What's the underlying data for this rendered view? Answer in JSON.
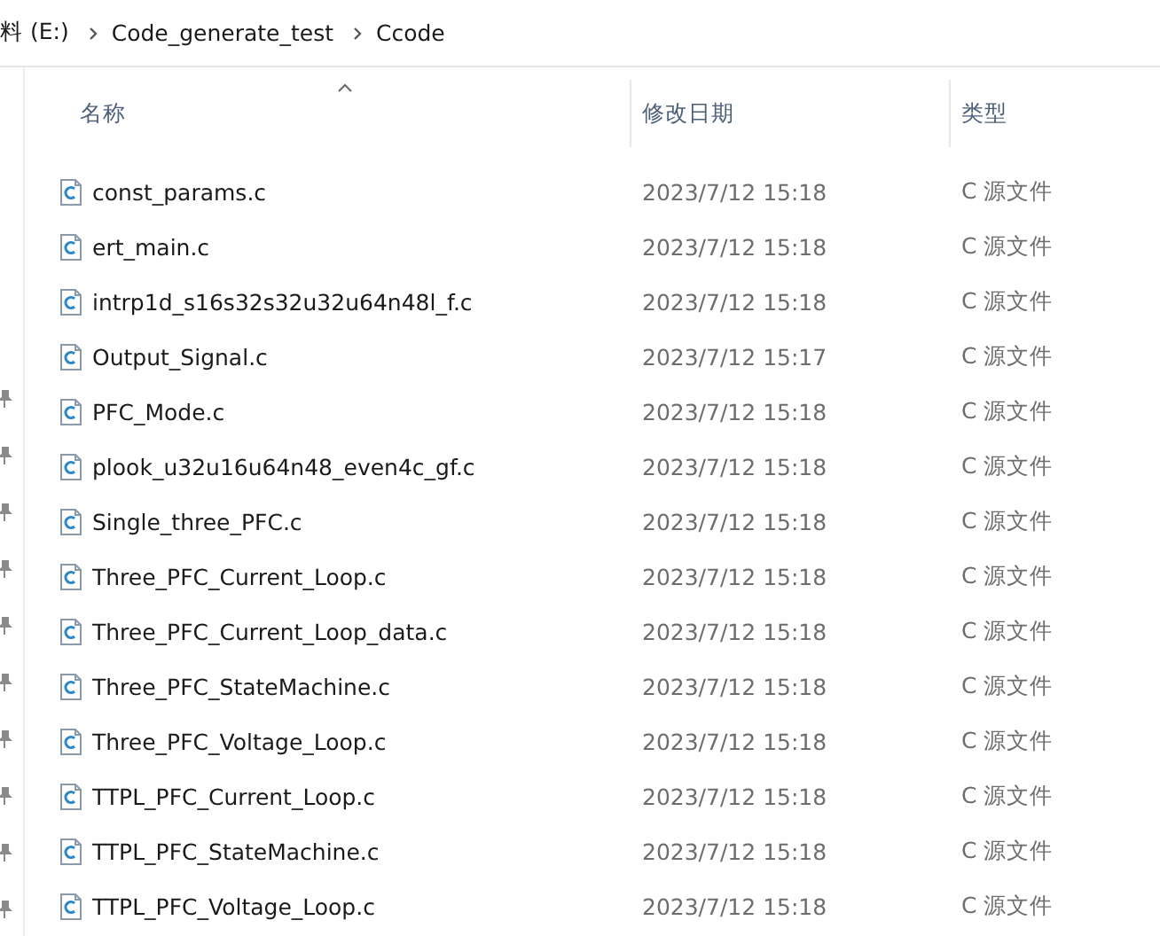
{
  "breadcrumb": [
    "料 (E:)",
    "Code_generate_test",
    "Ccode"
  ],
  "columns": [
    {
      "label": "名称",
      "sorted": true
    },
    {
      "label": "修改日期",
      "sorted": false
    },
    {
      "label": "类型",
      "sorted": false
    }
  ],
  "files": [
    {
      "name": "const_params.c",
      "modified": "2023/7/12 15:18",
      "type": "C 源文件"
    },
    {
      "name": "ert_main.c",
      "modified": "2023/7/12 15:18",
      "type": "C 源文件"
    },
    {
      "name": "intrp1d_s16s32s32u32u64n48l_f.c",
      "modified": "2023/7/12 15:18",
      "type": "C 源文件"
    },
    {
      "name": "Output_Signal.c",
      "modified": "2023/7/12 15:17",
      "type": "C 源文件"
    },
    {
      "name": "PFC_Mode.c",
      "modified": "2023/7/12 15:18",
      "type": "C 源文件"
    },
    {
      "name": "plook_u32u16u64n48_even4c_gf.c",
      "modified": "2023/7/12 15:18",
      "type": "C 源文件"
    },
    {
      "name": "Single_three_PFC.c",
      "modified": "2023/7/12 15:18",
      "type": "C 源文件"
    },
    {
      "name": "Three_PFC_Current_Loop.c",
      "modified": "2023/7/12 15:18",
      "type": "C 源文件"
    },
    {
      "name": "Three_PFC_Current_Loop_data.c",
      "modified": "2023/7/12 15:18",
      "type": "C 源文件"
    },
    {
      "name": "Three_PFC_StateMachine.c",
      "modified": "2023/7/12 15:18",
      "type": "C 源文件"
    },
    {
      "name": "Three_PFC_Voltage_Loop.c",
      "modified": "2023/7/12 15:18",
      "type": "C 源文件"
    },
    {
      "name": "TTPL_PFC_Current_Loop.c",
      "modified": "2023/7/12 15:18",
      "type": "C 源文件"
    },
    {
      "name": "TTPL_PFC_StateMachine.c",
      "modified": "2023/7/12 15:18",
      "type": "C 源文件"
    },
    {
      "name": "TTPL_PFC_Voltage_Loop.c",
      "modified": "2023/7/12 15:18",
      "type": "C 源文件"
    }
  ]
}
